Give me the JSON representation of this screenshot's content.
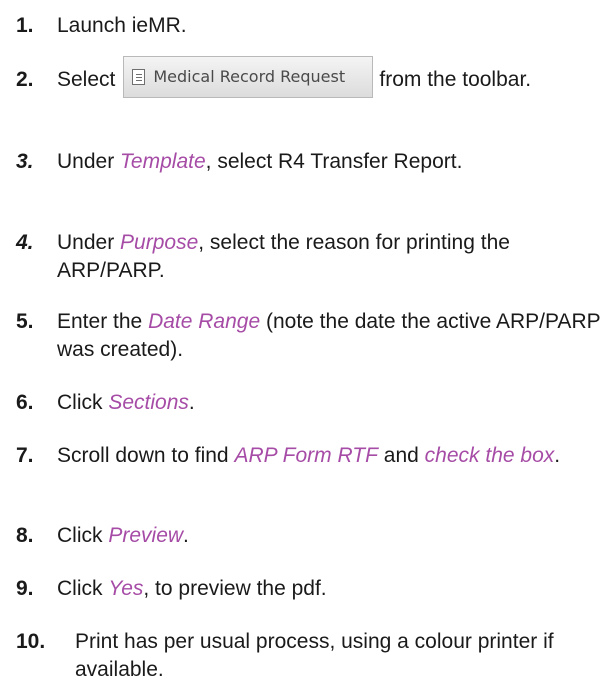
{
  "steps": [
    {
      "num": "1.",
      "parts": [
        {
          "t": "Launch ieMR."
        }
      ]
    },
    {
      "num": "2.",
      "parts": [
        {
          "t": "Select"
        },
        {
          "button": "Medical Record Request"
        },
        {
          "t": "from the toolbar."
        }
      ]
    },
    {
      "num": "3.",
      "num_italic": true,
      "parts": [
        {
          "t": "Under "
        },
        {
          "em": "Template"
        },
        {
          "t": ", select R4 Transfer Report."
        }
      ]
    },
    {
      "num": "4.",
      "num_italic": true,
      "parts": [
        {
          "t": "Under "
        },
        {
          "em": "Purpose"
        },
        {
          "t": ", select the reason for printing the ARP/PARP."
        }
      ]
    },
    {
      "num": "5.",
      "parts": [
        {
          "t": "Enter the "
        },
        {
          "em": "Date Range"
        },
        {
          "t": " (note the date the active ARP/PARP was created)."
        }
      ]
    },
    {
      "num": "6.",
      "parts": [
        {
          "t": "Click "
        },
        {
          "em": "Sections"
        },
        {
          "t": "."
        }
      ]
    },
    {
      "num": "7.",
      "parts": [
        {
          "t": "Scroll down to find "
        },
        {
          "em": "ARP Form RTF"
        },
        {
          "t": " and "
        },
        {
          "em": "check the box"
        },
        {
          "t": "."
        }
      ]
    },
    {
      "num": "8.",
      "parts": [
        {
          "t": "Click "
        },
        {
          "em": "Preview"
        },
        {
          "t": "."
        }
      ]
    },
    {
      "num": "9.",
      "parts": [
        {
          "t": "Click "
        },
        {
          "em": "Yes"
        },
        {
          "t": ", to preview the pdf."
        }
      ]
    },
    {
      "num": "10.",
      "parts": [
        {
          "t": "Print has per usual process, using a colour printer if available."
        }
      ]
    }
  ],
  "colors": {
    "emphasis": "#a64ca6",
    "text": "#1a1a1a"
  },
  "icons": {
    "toolbar_button": "document-icon"
  }
}
